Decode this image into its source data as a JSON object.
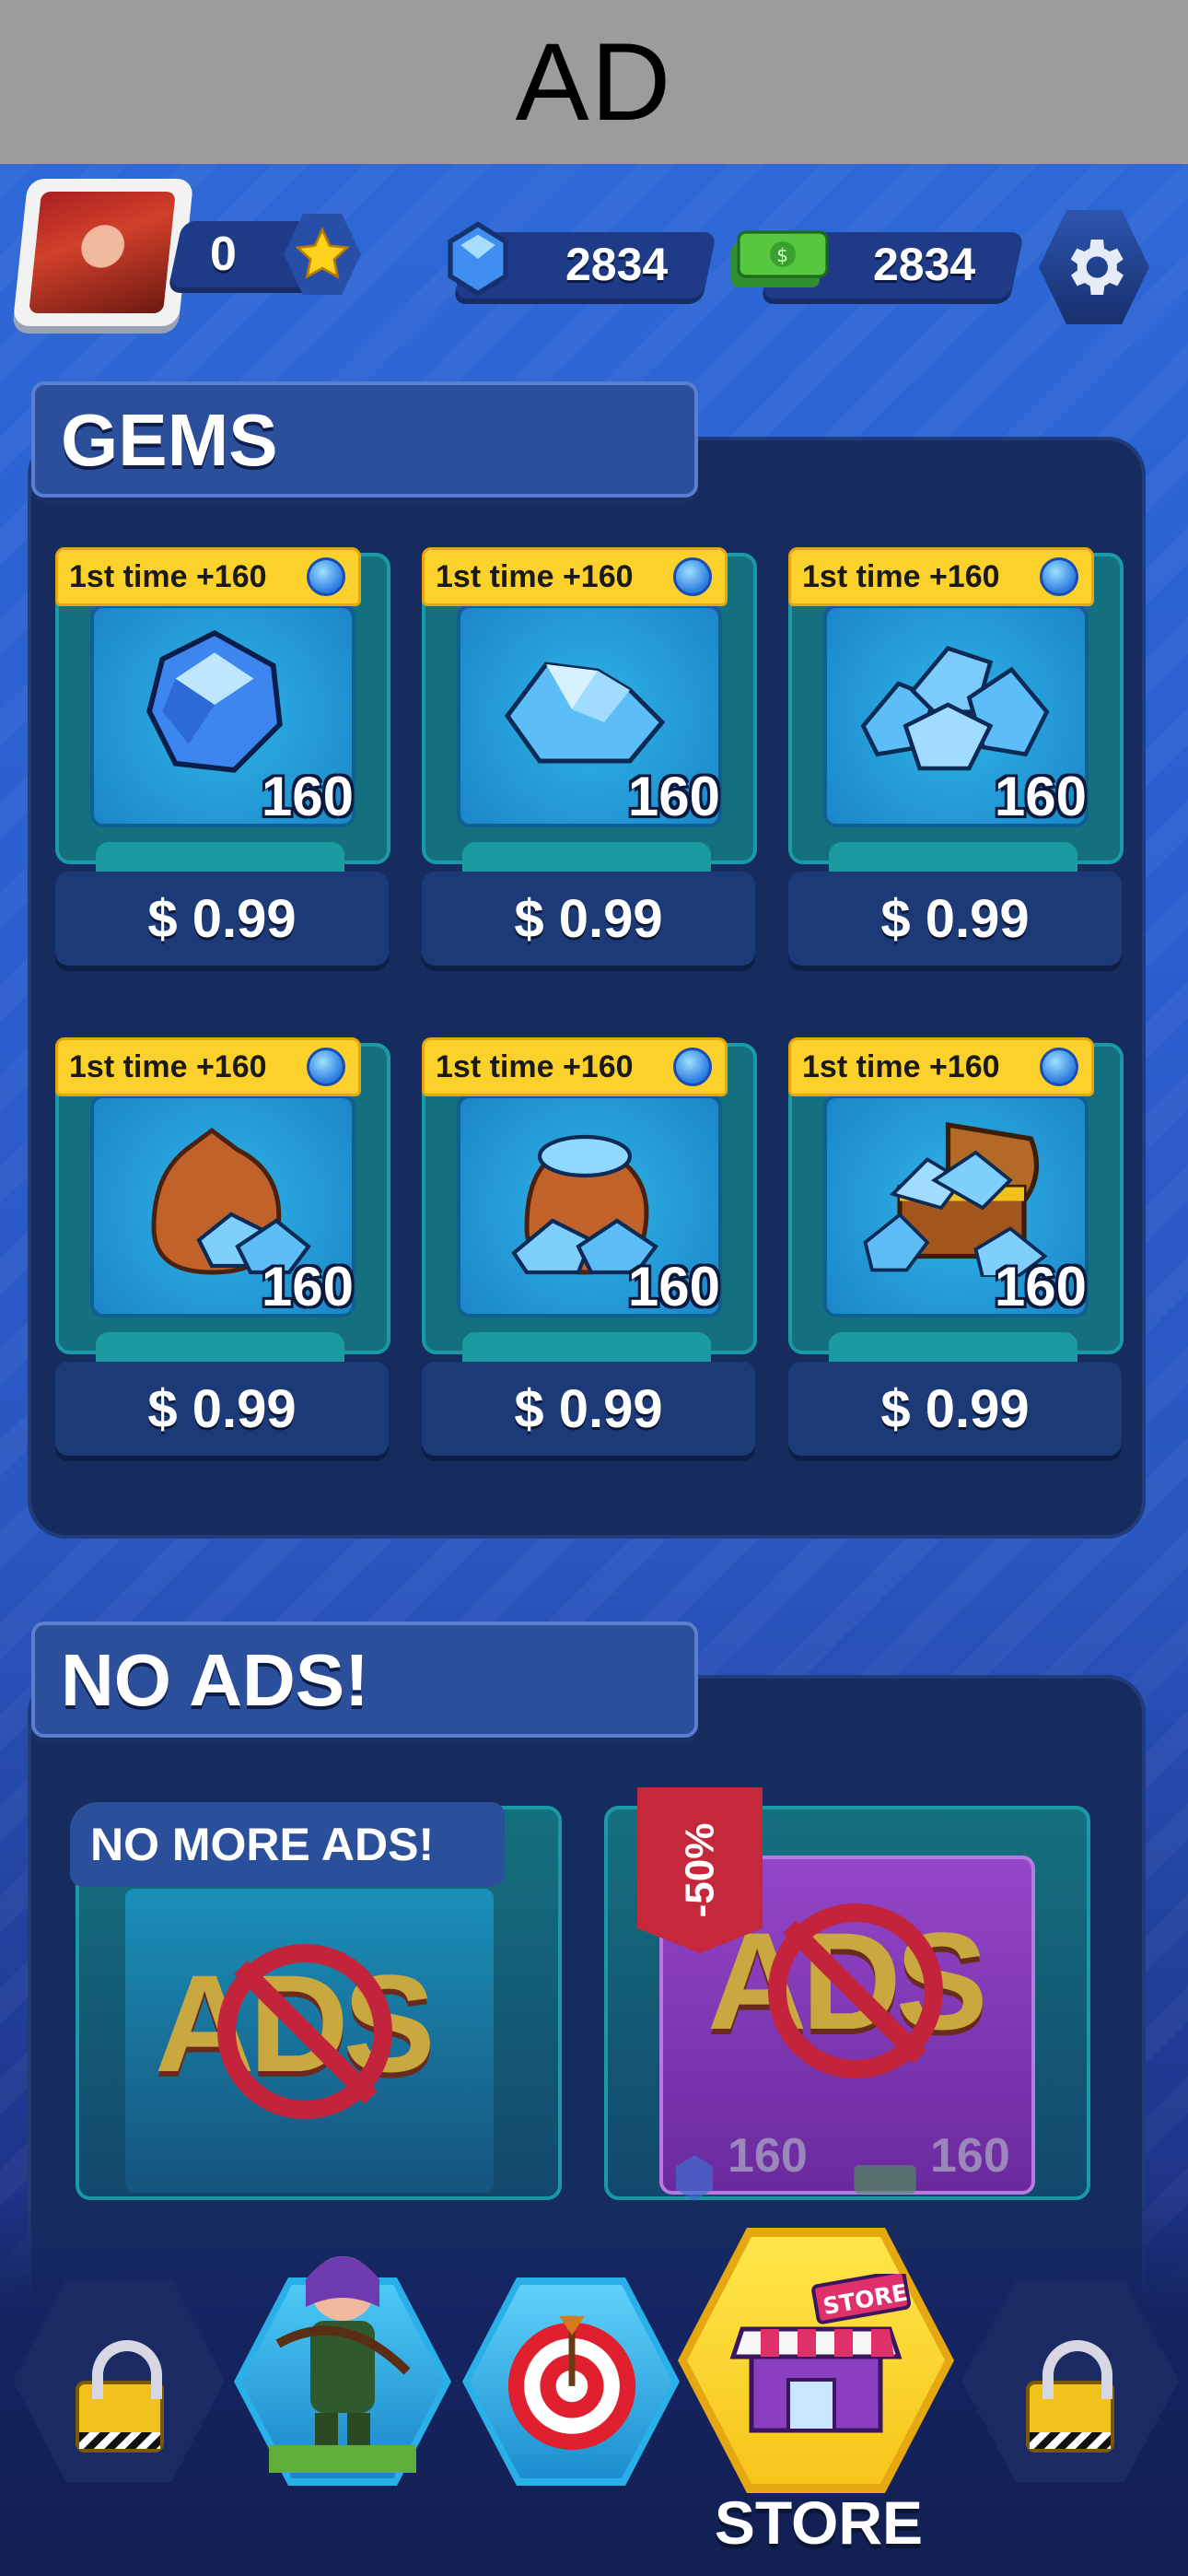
{
  "ad_banner": {
    "label": "AD"
  },
  "hud": {
    "stars": "0",
    "gems": "2834",
    "cash": "2834"
  },
  "gems_section": {
    "title": "GEMS",
    "items": [
      {
        "ribbon": "1st time +160",
        "amount": "160",
        "price": "$ 0.99",
        "icon": "single-gem-icon"
      },
      {
        "ribbon": "1st time +160",
        "amount": "160",
        "price": "$ 0.99",
        "icon": "gem-pile-icon"
      },
      {
        "ribbon": "1st time +160",
        "amount": "160",
        "price": "$ 0.99",
        "icon": "gem-heap-icon"
      },
      {
        "ribbon": "1st time +160",
        "amount": "160",
        "price": "$ 0.99",
        "icon": "gem-sack-icon"
      },
      {
        "ribbon": "1st time +160",
        "amount": "160",
        "price": "$ 0.99",
        "icon": "gem-bag-overflow-icon"
      },
      {
        "ribbon": "1st time +160",
        "amount": "160",
        "price": "$ 0.99",
        "icon": "gem-chest-icon"
      }
    ]
  },
  "no_ads_section": {
    "title": "NO ADS!",
    "card1": {
      "title": "NO MORE ADS!",
      "art_text": "ADS"
    },
    "card2": {
      "discount": "-50%",
      "art_text": "ADS",
      "gem_bonus": "160",
      "cash_bonus": "160"
    }
  },
  "bottom_nav": {
    "store_label": "STORE",
    "store_sign": "STORE"
  },
  "colors": {
    "accent_yellow": "#fdd12b",
    "panel_blue": "#162c5e",
    "card_teal": "#14707e",
    "discount_red": "#c5283a"
  }
}
